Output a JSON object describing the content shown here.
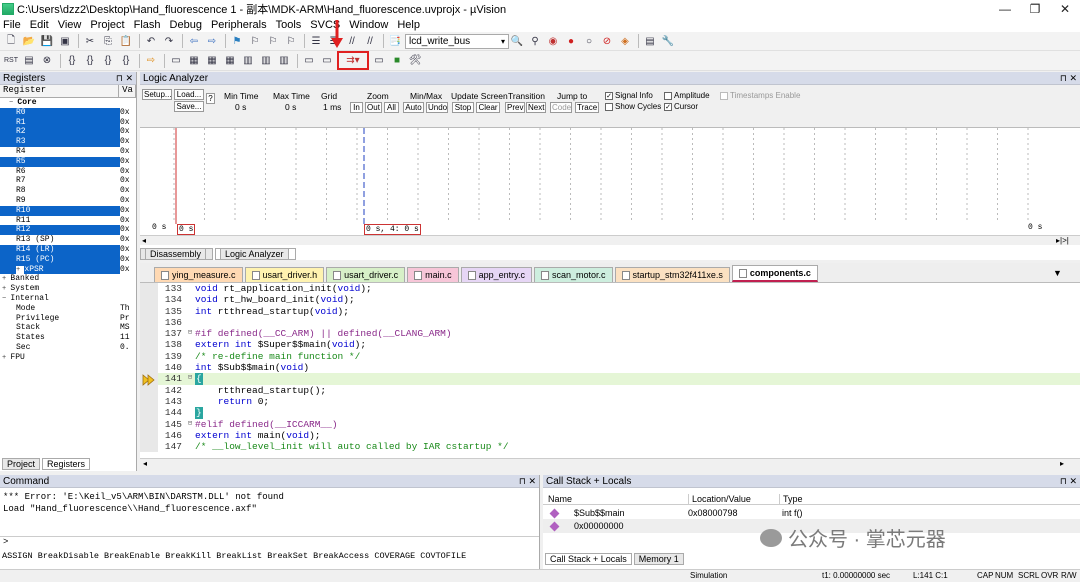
{
  "window": {
    "title": "C:\\Users\\dzz2\\Desktop\\Hand_fluorescence  1 - 副本\\MDK-ARM\\Hand_fluorescence.uvprojx - µVision",
    "controls": [
      "—",
      "❐",
      "✕"
    ]
  },
  "menu": [
    "File",
    "Edit",
    "View",
    "Project",
    "Flash",
    "Debug",
    "Peripherals",
    "Tools",
    "SVCS",
    "Window",
    "Help"
  ],
  "toolbar": {
    "target_dropdown": "lcd_write_bus",
    "highlight_color": "#e02020"
  },
  "registers": {
    "title": "Registers",
    "col_register": "Register",
    "col_value": "Va",
    "rows": [
      {
        "name": "Core",
        "value": "",
        "indent": 1,
        "sel": false,
        "expand": "−"
      },
      {
        "name": "R0",
        "value": "0x",
        "indent": 2,
        "sel": true
      },
      {
        "name": "R1",
        "value": "0x",
        "indent": 2,
        "sel": true
      },
      {
        "name": "R2",
        "value": "0x",
        "indent": 2,
        "sel": true
      },
      {
        "name": "R3",
        "value": "0x",
        "indent": 2,
        "sel": true
      },
      {
        "name": "R4",
        "value": "0x",
        "indent": 2,
        "sel": false
      },
      {
        "name": "R5",
        "value": "0x",
        "indent": 2,
        "sel": true
      },
      {
        "name": "R6",
        "value": "0x",
        "indent": 2,
        "sel": false
      },
      {
        "name": "R7",
        "value": "0x",
        "indent": 2,
        "sel": false
      },
      {
        "name": "R8",
        "value": "0x",
        "indent": 2,
        "sel": false
      },
      {
        "name": "R9",
        "value": "0x",
        "indent": 2,
        "sel": false
      },
      {
        "name": "R10",
        "value": "0x",
        "indent": 2,
        "sel": true
      },
      {
        "name": "R11",
        "value": "0x",
        "indent": 2,
        "sel": false
      },
      {
        "name": "R12",
        "value": "0x",
        "indent": 2,
        "sel": true
      },
      {
        "name": "R13 (SP)",
        "value": "0x",
        "indent": 2,
        "sel": false
      },
      {
        "name": "R14 (LR)",
        "value": "0x",
        "indent": 2,
        "sel": true
      },
      {
        "name": "R15 (PC)",
        "value": "0x",
        "indent": 2,
        "sel": true
      },
      {
        "name": "xPSR",
        "value": "0x",
        "indent": 2,
        "sel": true,
        "expand": "+"
      },
      {
        "name": "Banked",
        "value": "",
        "indent": 0,
        "sel": false,
        "expand": "+"
      },
      {
        "name": "System",
        "value": "",
        "indent": 0,
        "sel": false,
        "expand": "+"
      },
      {
        "name": "Internal",
        "value": "",
        "indent": 0,
        "sel": false,
        "expand": "−"
      },
      {
        "name": "Mode",
        "value": "Th",
        "indent": 2,
        "sel": false
      },
      {
        "name": "Privilege",
        "value": "Pr",
        "indent": 2,
        "sel": false
      },
      {
        "name": "Stack",
        "value": "MS",
        "indent": 2,
        "sel": false
      },
      {
        "name": "States",
        "value": "11",
        "indent": 2,
        "sel": false
      },
      {
        "name": "Sec",
        "value": "0.",
        "indent": 2,
        "sel": false
      },
      {
        "name": "FPU",
        "value": "",
        "indent": 0,
        "sel": false,
        "expand": "+"
      }
    ],
    "tab_project": "Project",
    "tab_registers": "Registers"
  },
  "logic": {
    "title": "Logic Analyzer",
    "setup": "Setup...",
    "load": "Load...",
    "save": "Save...",
    "help": "?",
    "min_time_label": "Min Time",
    "min_time": "0 s",
    "max_time_label": "Max Time",
    "max_time": "0 s",
    "grid_label": "Grid",
    "grid": "1 ms",
    "zoom_label": "Zoom",
    "zoom_in": "In",
    "zoom_out": "Out",
    "zoom_all": "All",
    "minmax_label": "Min/Max",
    "auto": "Auto",
    "undo": "Undo",
    "update_label": "Update Screen",
    "stop": "Stop",
    "clear": "Clear",
    "transition_label": "Transition",
    "prev": "Prev",
    "next": "Next",
    "jump_label": "Jump to",
    "code": "Code",
    "trace": "Trace",
    "signal_info": "Signal Info",
    "show_cycles": "Show Cycles",
    "amplitude": "Amplitude",
    "cursor": "Cursor",
    "timestamps": "Timestamps Enable",
    "time_left": "0 s",
    "time_marker0": "0 s",
    "time_cursor": "0 s,  4: 0 s",
    "time_right": "0 s"
  },
  "views": {
    "disassembly": "Disassembly",
    "logic": "Logic Analyzer"
  },
  "file_tabs": [
    {
      "name": "ying_measure.c",
      "color": "#ffd9b3"
    },
    {
      "name": "usart_driver.h",
      "color": "#fff3b0"
    },
    {
      "name": "usart_driver.c",
      "color": "#d7f0c8"
    },
    {
      "name": "main.c",
      "color": "#f7c6d8"
    },
    {
      "name": "app_entry.c",
      "color": "#e6d6f5"
    },
    {
      "name": "scan_motor.c",
      "color": "#cdeede"
    },
    {
      "name": "startup_stm32f411xe.s",
      "color": "#fbe1c2"
    },
    {
      "name": "components.c",
      "color": "#ffffff",
      "active": true
    }
  ],
  "code": [
    {
      "n": "133",
      "t": "void rt_application_init(void);",
      "k": "n"
    },
    {
      "n": "134",
      "t": "void rt_hw_board_init(void);",
      "k": "n"
    },
    {
      "n": "135",
      "t": "int rtthread_startup(void);",
      "k": "n"
    },
    {
      "n": "136",
      "t": "",
      "k": "n"
    },
    {
      "n": "137",
      "t": "#if defined(__CC_ARM) || defined(__CLANG_ARM)",
      "k": "p",
      "f": "⊟"
    },
    {
      "n": "138",
      "t": "extern int $Super$$main(void);",
      "k": "n"
    },
    {
      "n": "139",
      "t": "/* re-define main function */",
      "k": "c"
    },
    {
      "n": "140",
      "t": "int $Sub$$main(void)",
      "k": "n"
    },
    {
      "n": "141",
      "t": "{",
      "k": "n",
      "f": "⊟",
      "cur": true
    },
    {
      "n": "142",
      "t": "    rtthread_startup();",
      "k": "n"
    },
    {
      "n": "143",
      "t": "    return 0;",
      "k": "n"
    },
    {
      "n": "144",
      "t": "}",
      "k": "n"
    },
    {
      "n": "145",
      "t": "#elif defined(__ICCARM__)",
      "k": "p",
      "f": "⊟"
    },
    {
      "n": "146",
      "t": "extern int main(void);",
      "k": "n"
    },
    {
      "n": "147",
      "t": "/* __low_level_init will auto called by IAR cstartup */",
      "k": "c"
    }
  ],
  "command": {
    "title": "Command",
    "lines": [
      "*** Error: 'E:\\Keil_v5\\ARM\\BIN\\DARSTM.DLL' not found",
      "Load \"Hand_fluorescence\\\\Hand_fluorescence.axf\""
    ],
    "prompt": ">",
    "hint": "ASSIGN BreakDisable BreakEnable BreakKill BreakList BreakSet BreakAccess COVERAGE COVTOFILE"
  },
  "callstack": {
    "title": "Call Stack + Locals",
    "col_name": "Name",
    "col_loc": "Location/Value",
    "col_type": "Type",
    "rows": [
      {
        "name": "$Sub$$main",
        "loc": "0x08000798",
        "type": "int f()"
      },
      {
        "name": "0x00000000",
        "loc": "",
        "type": ""
      }
    ],
    "tab_call": "Call Stack + Locals",
    "tab_mem": "Memory 1"
  },
  "watermark": "公众号 · 掌芯元器",
  "status": {
    "mode": "Simulation",
    "time": "t1: 0.00000000 sec",
    "pos": "L:141 C:1",
    "caps": "CAP",
    "num": "NUM",
    "scrl": "SCRL",
    "ovr": "OVR",
    "rw": "R/W"
  }
}
